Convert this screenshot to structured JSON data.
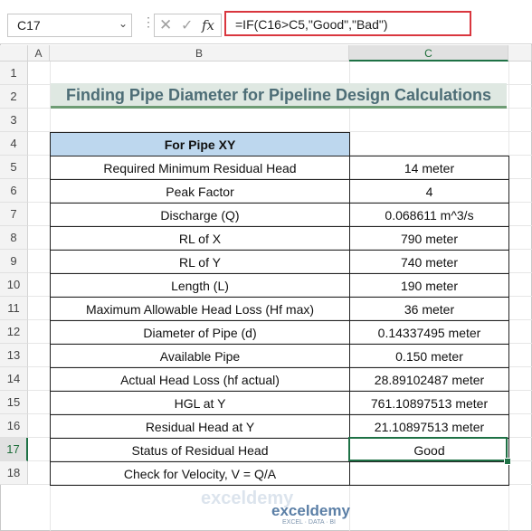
{
  "formula_bar": {
    "name_box": "C17",
    "cancel_icon": "x-icon",
    "enter_icon": "check-icon",
    "fx_label": "fx",
    "formula": "=IF(C16>C5,\"Good\",\"Bad\")"
  },
  "columns": [
    "A",
    "B",
    "C"
  ],
  "rows": [
    "1",
    "2",
    "3",
    "4",
    "5",
    "6",
    "7",
    "8",
    "9",
    "10",
    "11",
    "12",
    "13",
    "14",
    "15",
    "16",
    "17",
    "18"
  ],
  "title": "Finding Pipe Diameter for Pipeline Design Calculations",
  "table": {
    "header": "For Pipe XY",
    "rows": [
      {
        "label": "Required Minimum Residual Head",
        "value": "14 meter"
      },
      {
        "label": "Peak Factor",
        "value": "4"
      },
      {
        "label": "Discharge (Q)",
        "value": "0.068611 m^3/s"
      },
      {
        "label": "RL of X",
        "value": "790 meter"
      },
      {
        "label": "RL of Y",
        "value": "740 meter"
      },
      {
        "label": "Length (L)",
        "value": "190 meter"
      },
      {
        "label": "Maximum Allowable Head Loss (Hf max)",
        "value": "36 meter"
      },
      {
        "label": "Diameter of Pipe (d)",
        "value": "0.14337495 meter"
      },
      {
        "label": "Available Pipe",
        "value": "0.150 meter"
      },
      {
        "label": "Actual Head Loss (hf actual)",
        "value": "28.89102487 meter"
      },
      {
        "label": "HGL at Y",
        "value": "761.10897513 meter"
      },
      {
        "label": "Residual Head at Y",
        "value": "21.10897513 meter"
      },
      {
        "label": "Status of Residual Head",
        "value": "Good"
      },
      {
        "label": "Check for Velocity, V = Q/A",
        "value": ""
      }
    ]
  },
  "watermark": {
    "brand": "exceldemy",
    "tagline": "EXCEL · DATA · BI"
  }
}
